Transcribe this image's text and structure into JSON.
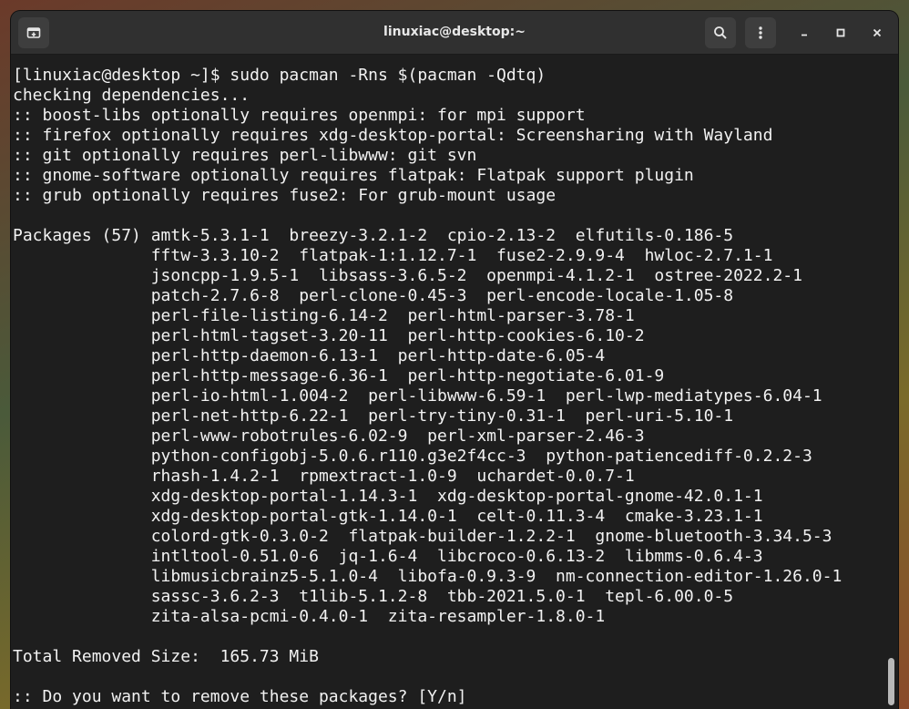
{
  "window": {
    "title": "linuxiac@desktop:~"
  },
  "icons": {
    "new_tab": "new-tab-icon",
    "search": "search-icon",
    "menu": "kebab-menu-icon",
    "minimize": "minimize-icon",
    "maximize": "maximize-icon",
    "close": "close-icon"
  },
  "colors": {
    "terminal_bg": "#1e1e1e",
    "terminal_fg": "#f2f2f2",
    "headerbar_bg": "#303030"
  },
  "terminal": {
    "lines": [
      "[linuxiac@desktop ~]$ sudo pacman -Rns $(pacman -Qdtq)",
      "checking dependencies...",
      ":: boost-libs optionally requires openmpi: for mpi support",
      ":: firefox optionally requires xdg-desktop-portal: Screensharing with Wayland",
      ":: git optionally requires perl-libwww: git svn",
      ":: gnome-software optionally requires flatpak: Flatpak support plugin",
      ":: grub optionally requires fuse2: For grub-mount usage",
      "",
      "Packages (57) amtk-5.3.1-1  breezy-3.2.1-2  cpio-2.13-2  elfutils-0.186-5",
      "              fftw-3.3.10-2  flatpak-1:1.12.7-1  fuse2-2.9.9-4  hwloc-2.7.1-1",
      "              jsoncpp-1.9.5-1  libsass-3.6.5-2  openmpi-4.1.2-1  ostree-2022.2-1",
      "              patch-2.7.6-8  perl-clone-0.45-3  perl-encode-locale-1.05-8",
      "              perl-file-listing-6.14-2  perl-html-parser-3.78-1",
      "              perl-html-tagset-3.20-11  perl-http-cookies-6.10-2",
      "              perl-http-daemon-6.13-1  perl-http-date-6.05-4",
      "              perl-http-message-6.36-1  perl-http-negotiate-6.01-9",
      "              perl-io-html-1.004-2  perl-libwww-6.59-1  perl-lwp-mediatypes-6.04-1",
      "              perl-net-http-6.22-1  perl-try-tiny-0.31-1  perl-uri-5.10-1",
      "              perl-www-robotrules-6.02-9  perl-xml-parser-2.46-3",
      "              python-configobj-5.0.6.r110.g3e2f4cc-3  python-patiencediff-0.2.2-3",
      "              rhash-1.4.2-1  rpmextract-1.0-9  uchardet-0.0.7-1",
      "              xdg-desktop-portal-1.14.3-1  xdg-desktop-portal-gnome-42.0.1-1",
      "              xdg-desktop-portal-gtk-1.14.0-1  celt-0.11.3-4  cmake-3.23.1-1",
      "              colord-gtk-0.3.0-2  flatpak-builder-1.2.2-1  gnome-bluetooth-3.34.5-3",
      "              intltool-0.51.0-6  jq-1.6-4  libcroco-0.6.13-2  libmms-0.6.4-3",
      "              libmusicbrainz5-5.1.0-4  libofa-0.9.3-9  nm-connection-editor-1.26.0-1",
      "              sassc-3.6.2-3  t1lib-5.1.2-8  tbb-2021.5.0-1  tepl-6.00.0-5",
      "              zita-alsa-pcmi-0.4.0-1  zita-resampler-1.8.0-1",
      "",
      "Total Removed Size:  165.73 MiB",
      "",
      ":: Do you want to remove these packages? [Y/n]"
    ]
  }
}
